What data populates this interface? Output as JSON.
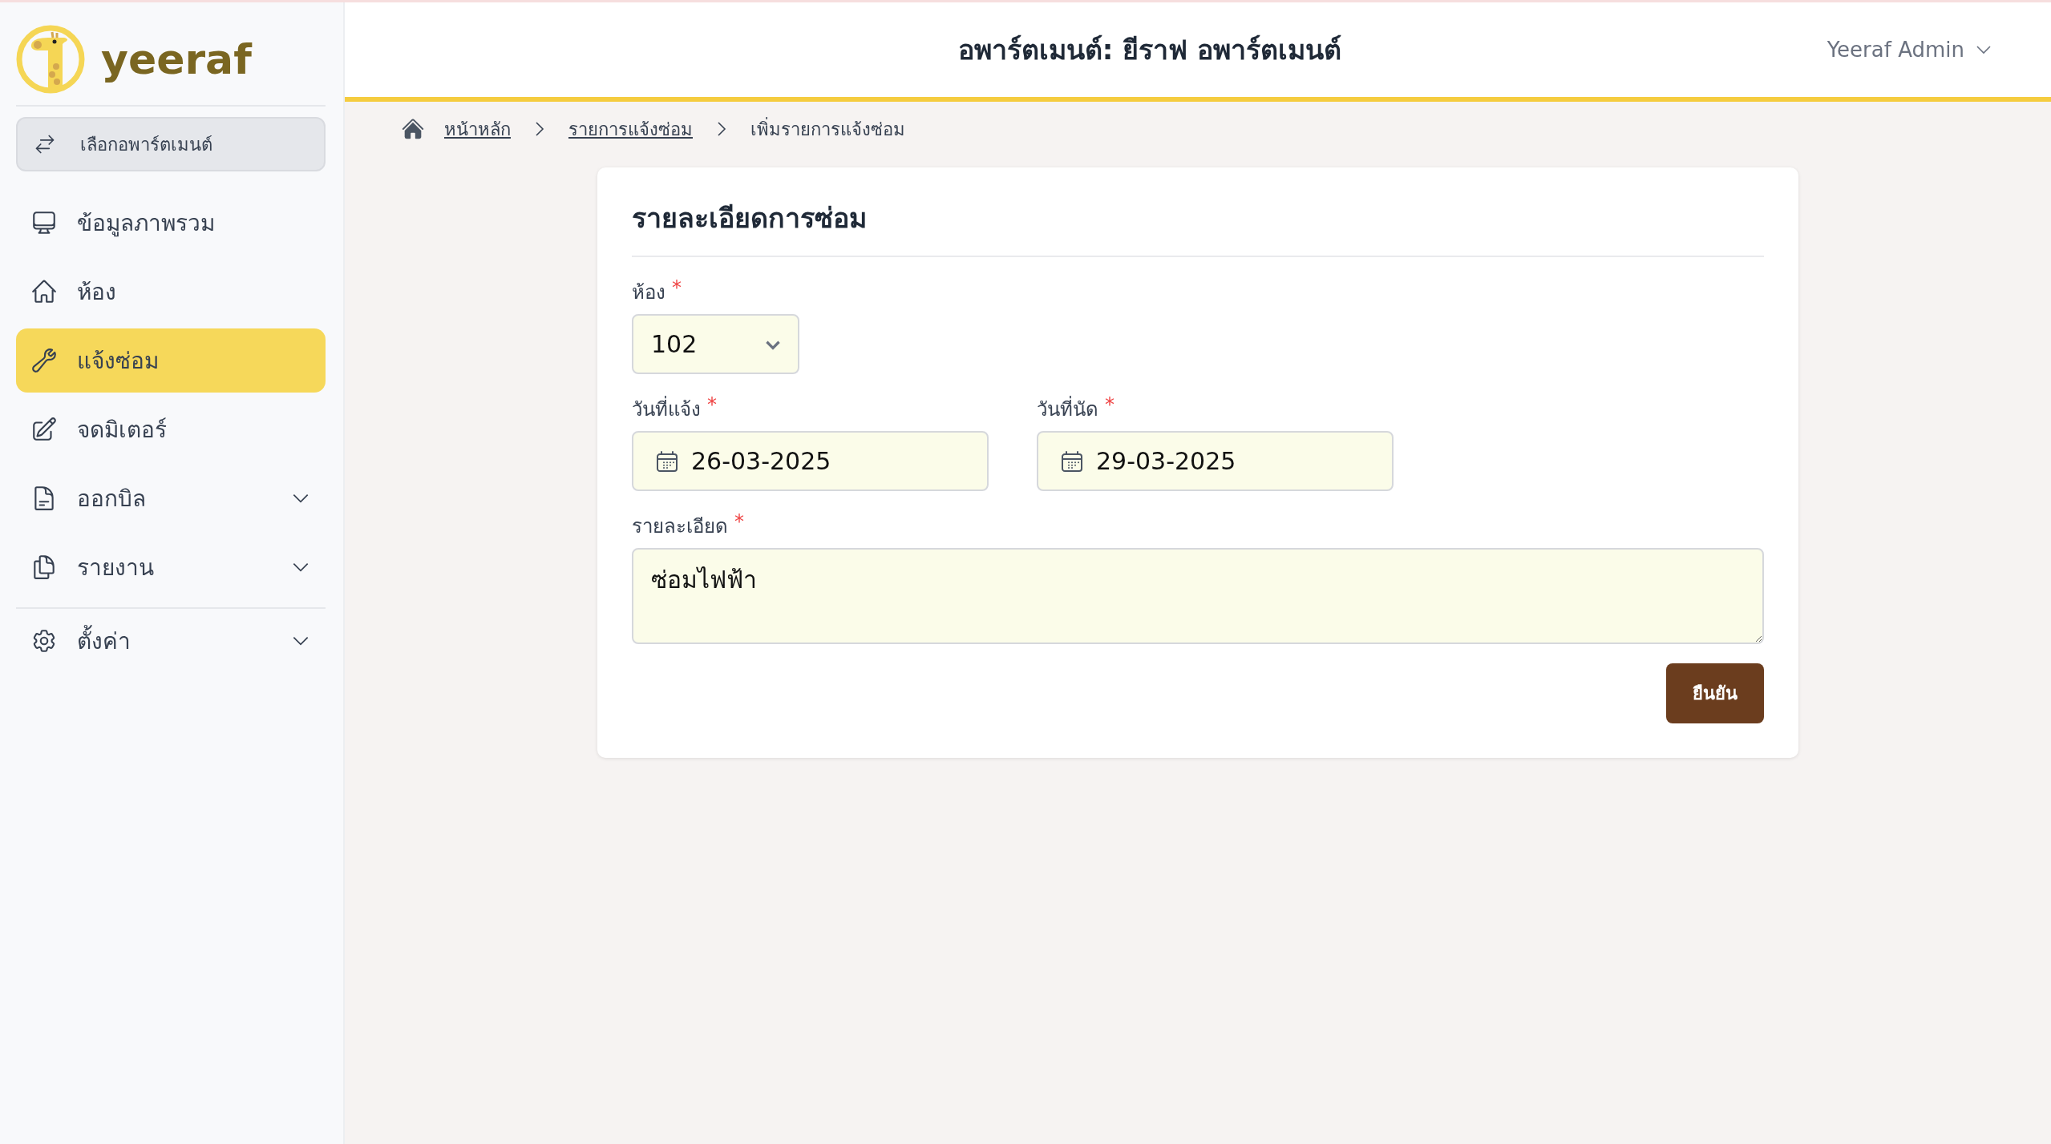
{
  "sidebar": {
    "logo": {
      "text": "yeeraf"
    },
    "apartment_button": "เลือกอพาร์ตเมนต์",
    "items": [
      {
        "label": "ข้อมูลภาพรวม",
        "selected": false,
        "expandable": false,
        "divider_above": false
      },
      {
        "label": "ห้อง",
        "selected": false,
        "expandable": false,
        "divider_above": false
      },
      {
        "label": "แจ้งซ่อม",
        "selected": true,
        "expandable": false,
        "divider_above": false
      },
      {
        "label": "จดมิเตอร์",
        "selected": false,
        "expandable": false,
        "divider_above": false
      },
      {
        "label": "ออกบิล",
        "selected": false,
        "expandable": true,
        "divider_above": false
      },
      {
        "label": "รายงาน",
        "selected": false,
        "expandable": true,
        "divider_above": false
      },
      {
        "label": "ตั้งค่า",
        "selected": false,
        "expandable": true,
        "divider_above": true
      }
    ]
  },
  "header": {
    "title": "อพาร์ตเมนต์: ยีราฟ อพาร์ตเมนต์",
    "user": "Yeeraf Admin"
  },
  "breadcrumb": [
    {
      "label": "หน้าหลัก",
      "current": false
    },
    {
      "label": "รายการแจ้งซ่อม",
      "current": false
    },
    {
      "label": "เพิ่มรายการแจ้งซ่อม",
      "current": true
    }
  ],
  "form": {
    "title": "รายละเอียดการซ่อม",
    "room": {
      "label": "ห้อง",
      "required_mark": "*",
      "value": "102"
    },
    "reported_date": {
      "label": "วันที่แจ้ง",
      "required_mark": "*",
      "value": "26-03-2025"
    },
    "appointment_date": {
      "label": "วันที่นัด",
      "required_mark": "*",
      "value": "29-03-2025"
    },
    "details": {
      "label": "รายละเอียด",
      "required_mark": "*",
      "value": "ซ่อมไฟฟ้า"
    },
    "submit": "ยืนยัน"
  }
}
